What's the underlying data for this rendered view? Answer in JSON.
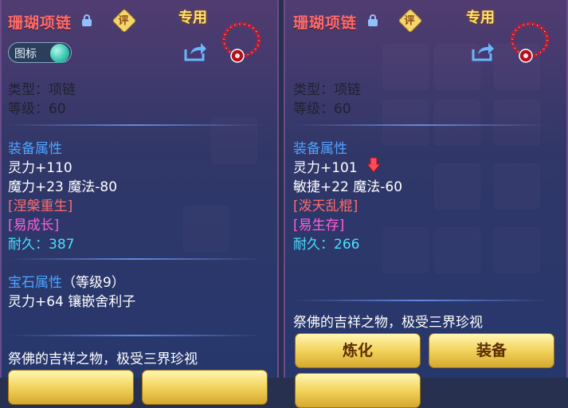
{
  "left": {
    "title": "珊瑚项链",
    "rate_label": "评",
    "special_label": "专用",
    "toggle_label": "图标",
    "type_line": "类型：项链",
    "level_line": "等级：60",
    "equip_section": "装备属性",
    "stat1": "灵力+110",
    "stat2": "魔力+23 魔法-80",
    "skill1": "[涅槃重生]",
    "skill2": "[易成长]",
    "durability": "耐久：387",
    "gem_section": "宝石属性",
    "gem_level": "（等级9）",
    "gem_stat": "灵力+64 镶嵌舍利子",
    "description": "祭佛的吉祥之物，极受三界珍视"
  },
  "right": {
    "title": "珊瑚项链",
    "rate_label": "评",
    "special_label": "专用",
    "type_line": "类型：项链",
    "level_line": "等级：60",
    "equip_section": "装备属性",
    "stat1": "灵力+101",
    "stat2": "敏捷+22 魔法-60",
    "skill1": "[泼天乱棍]",
    "skill2": "[易生存]",
    "durability": "耐久：266",
    "description": "祭佛的吉祥之物，极受三界珍视",
    "btn_refine": "炼化",
    "btn_equip": "装备"
  },
  "colors": {
    "title": "#ff6a6a",
    "section": "#4fa3ff",
    "skill_red": "#ff6c6c",
    "skill_pink": "#ff5fd6",
    "durability": "#48e0ff",
    "button": "#f2d35c"
  }
}
